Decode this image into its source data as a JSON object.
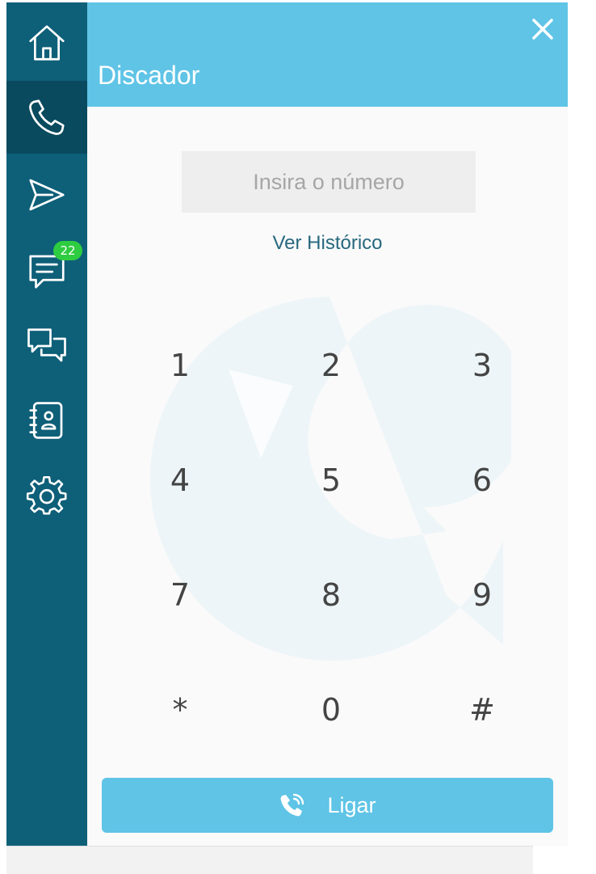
{
  "header": {
    "title": "Discador"
  },
  "sidebar": {
    "items": [
      {
        "icon": "home-icon"
      },
      {
        "icon": "phone-icon",
        "active": true
      },
      {
        "icon": "send-icon"
      },
      {
        "icon": "message-icon",
        "badge": "22"
      },
      {
        "icon": "conversations-icon"
      },
      {
        "icon": "contacts-book-icon"
      },
      {
        "icon": "settings-gear-icon"
      }
    ]
  },
  "dialer": {
    "placeholder": "Insira o número",
    "history_link": "Ver Histórico",
    "keys": [
      "1",
      "2",
      "3",
      "4",
      "5",
      "6",
      "7",
      "8",
      "9",
      "*",
      "0",
      "#"
    ],
    "call_label": "Ligar"
  },
  "colors": {
    "sidebar": "#0e5f78",
    "sidebar_active": "#0a4a5e",
    "accent": "#5fc4e6",
    "badge": "#2ecc40"
  }
}
